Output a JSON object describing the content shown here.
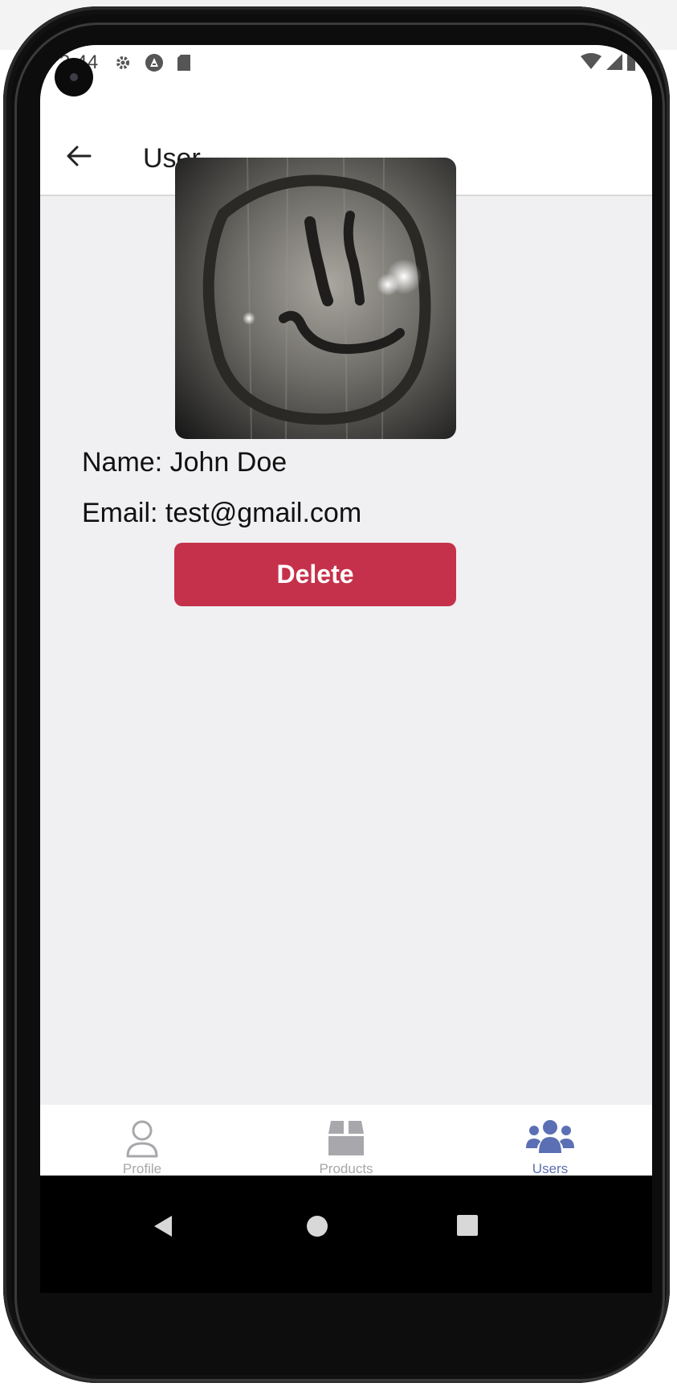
{
  "status_bar": {
    "time": "3:44",
    "left_icons": [
      "gear-icon",
      "a-badge-icon",
      "sd-card-icon"
    ],
    "right_icons": [
      "wifi-icon",
      "signal-icon",
      "battery-icon"
    ]
  },
  "header": {
    "back_icon": "arrow-left-icon",
    "title": "User"
  },
  "user": {
    "avatar_description": "photo",
    "name_line": "Name: John Doe",
    "email_line": "Email: test@gmail.com"
  },
  "actions": {
    "delete_label": "Delete",
    "delete_color": "#c5314b"
  },
  "tabs": [
    {
      "label": "Profile",
      "icon": "person-icon",
      "active": false
    },
    {
      "label": "Products",
      "icon": "box-icon",
      "active": false
    },
    {
      "label": "Users",
      "icon": "users-icon",
      "active": true
    }
  ],
  "colors": {
    "active_tab": "#5b6fb4",
    "inactive_tab": "#a8a8ac",
    "background": "#f0f0f2"
  },
  "system_nav": [
    "back-triangle-icon",
    "home-circle-icon",
    "recents-square-icon"
  ]
}
